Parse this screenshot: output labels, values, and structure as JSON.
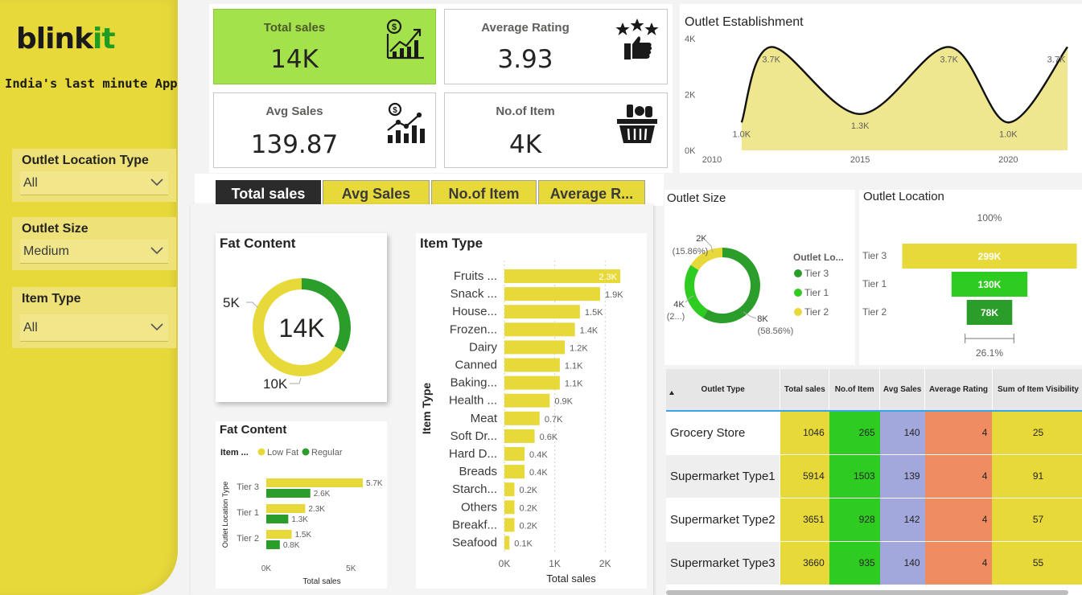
{
  "brand": {
    "name_main": "blink",
    "name_accent": "it",
    "tagline": "India's last minute App"
  },
  "colors": {
    "yellow": "#e8d93b",
    "green": "#2a9d2a",
    "lime": "#2ecc20",
    "kpi_green": "#a4e24c"
  },
  "slicers": [
    {
      "label": "Outlet Location Type",
      "value": "All"
    },
    {
      "label": "Outlet Size",
      "value": "Medium"
    },
    {
      "label": "Item Type",
      "value": "All"
    }
  ],
  "kpis": [
    {
      "label": "Total sales",
      "value": "14K",
      "icon": "money-growth-chart-icon"
    },
    {
      "label": "Average Rating",
      "value": "3.93",
      "icon": "stars-thumbs-up-icon"
    },
    {
      "label": "Avg Sales",
      "value": "139.87",
      "icon": "coin-bar-chart-icon"
    },
    {
      "label": "No.of Item",
      "value": "4K",
      "icon": "grocery-basket-icon"
    }
  ],
  "tabs": [
    "Total sales",
    "Avg Sales",
    "No.of Item",
    "Average R..."
  ],
  "chart_data": [
    {
      "id": "outlet-establishment",
      "type": "area",
      "title": "Outlet Establishment",
      "x": [
        2011,
        2012,
        2015,
        2018,
        2020,
        2022
      ],
      "y": [
        1.0,
        3.7,
        1.3,
        3.7,
        1.0,
        3.7
      ],
      "labels": [
        "1.0K",
        "3.7K",
        "1.3K",
        "3.7K",
        "1.0K",
        "3.7K"
      ],
      "xticks": [
        "2010",
        "2015",
        "2020"
      ],
      "yticks": [
        "0K",
        "2K",
        "4K"
      ],
      "ylim": [
        0,
        4
      ],
      "xlim": [
        2010,
        2022
      ]
    },
    {
      "id": "fat-content-donut",
      "type": "pie",
      "title": "Fat Content",
      "center_label": "14K",
      "categories": [
        "Regular",
        "Low Fat"
      ],
      "values": [
        5,
        10
      ],
      "labels": [
        "5K",
        "10K"
      ]
    },
    {
      "id": "fat-content-bars",
      "type": "bar",
      "title": "Fat Content",
      "legend_title": "Item ...",
      "categories": [
        "Tier 3",
        "Tier 1",
        "Tier 2"
      ],
      "series": [
        {
          "name": "Low Fat",
          "values": [
            5.7,
            2.3,
            1.5
          ],
          "labels": [
            "5.7K",
            "2.3K",
            "1.5K"
          ]
        },
        {
          "name": "Regular",
          "values": [
            2.6,
            1.3,
            0.8
          ],
          "labels": [
            "2.6K",
            "1.3K",
            "0.8K"
          ]
        }
      ],
      "ylabel": "Outlet Location Type",
      "xlabel": "Total sales",
      "xticks": [
        "0K",
        "5K"
      ],
      "xlim": [
        0,
        5.7
      ]
    },
    {
      "id": "item-type-bars",
      "type": "bar",
      "title": "Item Type",
      "ylabel": "Item Type",
      "xlabel": "Total sales",
      "categories": [
        "Fruits ...",
        "Snack ...",
        "House...",
        "Frozen...",
        "Dairy",
        "Canned",
        "Baking...",
        "Health ...",
        "Meat",
        "Soft Dr...",
        "Hard D...",
        "Breads",
        "Starch...",
        "Others",
        "Breakf...",
        "Seafood"
      ],
      "values": [
        2.3,
        1.9,
        1.5,
        1.4,
        1.2,
        1.1,
        1.1,
        0.9,
        0.7,
        0.6,
        0.4,
        0.4,
        0.2,
        0.2,
        0.2,
        0.1
      ],
      "labels": [
        "2.3K",
        "1.9K",
        "1.5K",
        "1.4K",
        "1.2K",
        "1.1K",
        "1.1K",
        "0.9K",
        "0.7K",
        "0.6K",
        "0.4K",
        "0.4K",
        "0.2K",
        "0.2K",
        "0.2K",
        "0.1K"
      ],
      "xticks": [
        "0K",
        "1K",
        "2K"
      ],
      "xlim": [
        0,
        2.3
      ]
    },
    {
      "id": "outlet-size-donut",
      "type": "pie",
      "title": "Outlet Size",
      "legend_title": "Outlet Lo...",
      "categories": [
        "Tier 3",
        "Tier 1",
        "Tier 2"
      ],
      "values": [
        58.56,
        25.58,
        15.86
      ],
      "labels": [
        "8K",
        "4K",
        "2K"
      ],
      "pct_labels": [
        "(58.56%)",
        "(2...)",
        "(15.86%)"
      ]
    },
    {
      "id": "outlet-location-funnel",
      "type": "bar",
      "title": "Outlet Location",
      "categories": [
        "Tier 3",
        "Tier 1",
        "Tier 2"
      ],
      "values": [
        299,
        130,
        78
      ],
      "labels": [
        "299K",
        "130K",
        "78K"
      ],
      "top_label": "100%",
      "bottom_label": "26.1%"
    }
  ],
  "table": {
    "headers": [
      "Outlet Type",
      "Total sales",
      "No.of Item",
      "Avg Sales",
      "Average Rating",
      "Sum of Item Visibility"
    ],
    "rows": [
      [
        "Grocery Store",
        "1046",
        "265",
        "140",
        "4",
        "25"
      ],
      [
        "Supermarket Type1",
        "5914",
        "1503",
        "139",
        "4",
        "91"
      ],
      [
        "Supermarket Type2",
        "3651",
        "928",
        "142",
        "4",
        "57"
      ],
      [
        "Supermarket Type3",
        "3660",
        "935",
        "140",
        "4",
        "55"
      ]
    ]
  }
}
